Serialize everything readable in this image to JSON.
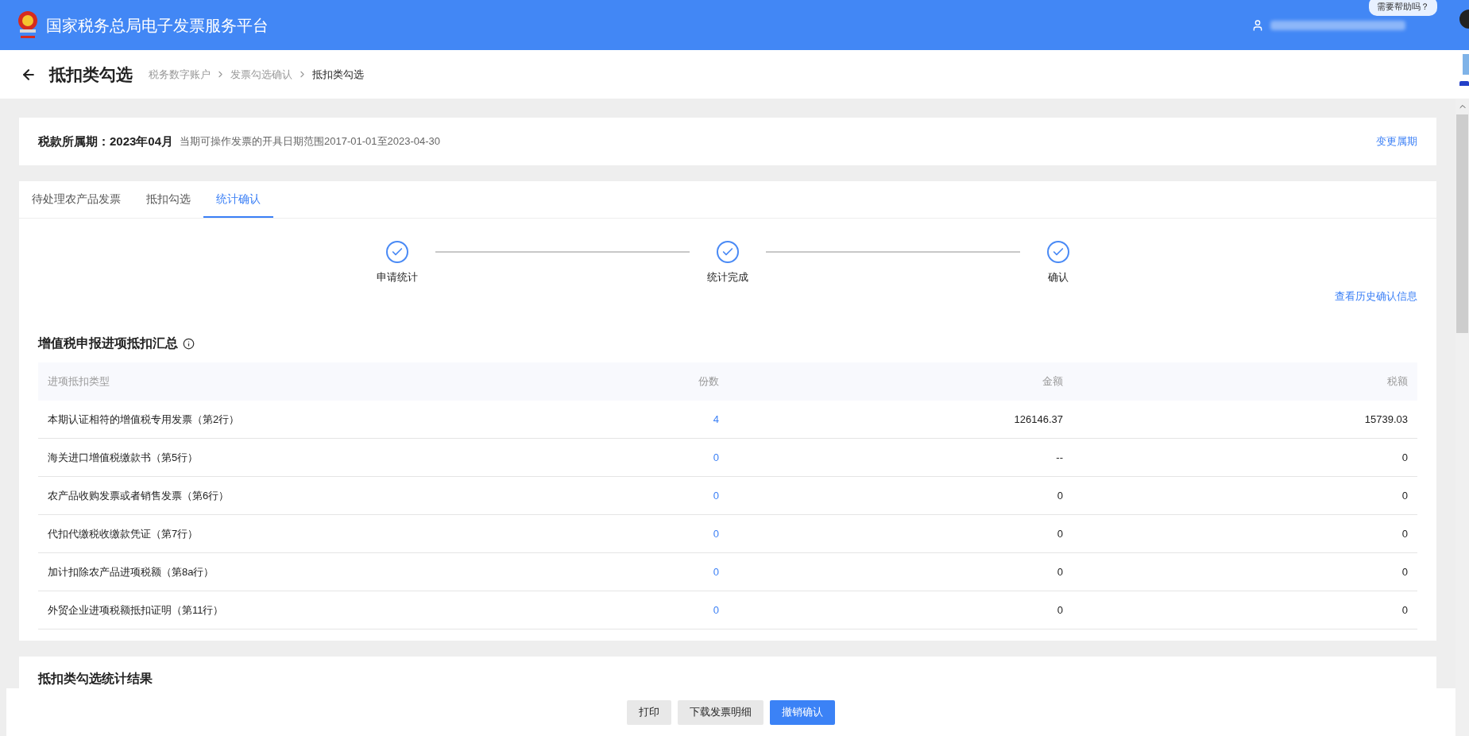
{
  "header": {
    "title": "国家税务总局电子发票服务平台",
    "help_bubble": "需要帮助吗？"
  },
  "page": {
    "title": "抵扣类勾选",
    "breadcrumb": [
      {
        "label": "税务数字账户",
        "current": false
      },
      {
        "label": "发票勾选确认",
        "current": false
      },
      {
        "label": "抵扣类勾选",
        "current": true
      }
    ]
  },
  "period": {
    "label": "税款所属期：",
    "value": "2023年04月",
    "range": "当期可操作发票的开具日期范围2017-01-01至2023-04-30",
    "action": "变更属期"
  },
  "tabs": [
    {
      "label": "待处理农产品发票",
      "selected": false
    },
    {
      "label": "抵扣勾选",
      "selected": false
    },
    {
      "label": "统计确认",
      "selected": true
    }
  ],
  "steps": [
    {
      "label": "申请统计",
      "done": true
    },
    {
      "label": "统计完成",
      "done": true
    },
    {
      "label": "确认",
      "done": true
    }
  ],
  "history_link": "查看历史确认信息",
  "summary": {
    "title": "增值税申报进项抵扣汇总",
    "columns": [
      "进项抵扣类型",
      "份数",
      "金额",
      "税额"
    ],
    "rows": [
      {
        "type": "本期认证相符的增值税专用发票（第2行）",
        "count": "4",
        "amount": "126146.37",
        "tax": "15739.03"
      },
      {
        "type": "海关进口增值税缴款书（第5行）",
        "count": "0",
        "amount": "--",
        "tax": "0"
      },
      {
        "type": "农产品收购发票或者销售发票（第6行）",
        "count": "0",
        "amount": "0",
        "tax": "0"
      },
      {
        "type": "代扣代缴税收缴款凭证（第7行）",
        "count": "0",
        "amount": "0",
        "tax": "0"
      },
      {
        "type": "加计扣除农产品进项税额（第8a行）",
        "count": "0",
        "amount": "0",
        "tax": "0"
      },
      {
        "type": "外贸企业进项税额抵扣证明（第11行）",
        "count": "0",
        "amount": "0",
        "tax": "0"
      }
    ]
  },
  "result_section": {
    "title": "抵扣类勾选统计结果"
  },
  "buttons": [
    {
      "label": "打印",
      "primary": false
    },
    {
      "label": "下载发票明细",
      "primary": false
    },
    {
      "label": "撤销确认",
      "primary": true
    }
  ]
}
